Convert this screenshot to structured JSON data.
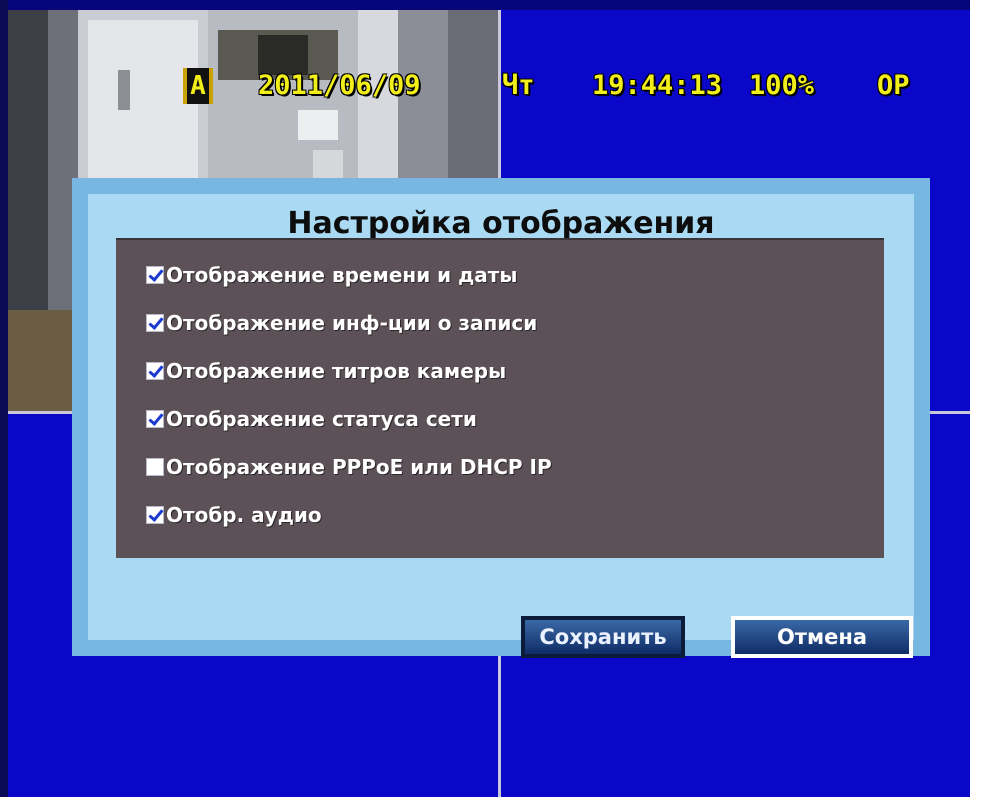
{
  "osd": {
    "channel": "A",
    "date": "2011/06/09",
    "weekday": "Чт",
    "time": "19:44:13",
    "hdd_usage": "100%",
    "record_mode": "OP"
  },
  "dialog": {
    "title": "Настройка отображения",
    "options": [
      {
        "label": "Отображение времени и даты",
        "checked": true
      },
      {
        "label": "Отображение инф-ции о записи",
        "checked": true
      },
      {
        "label": "Отображение титров камеры",
        "checked": true
      },
      {
        "label": "Отображение статуса сети",
        "checked": true
      },
      {
        "label": "Отображение PPPoE или DHCP IP",
        "checked": false
      },
      {
        "label": "Отобр. аудио",
        "checked": true
      }
    ],
    "save_label": "Сохранить",
    "cancel_label": "Отмена"
  },
  "colors": {
    "background_blue": "#0b07c8",
    "osd_text": "#f2ee1a",
    "dialog_bg": "#a9d9f3",
    "panel_bg": "#5b5156"
  }
}
